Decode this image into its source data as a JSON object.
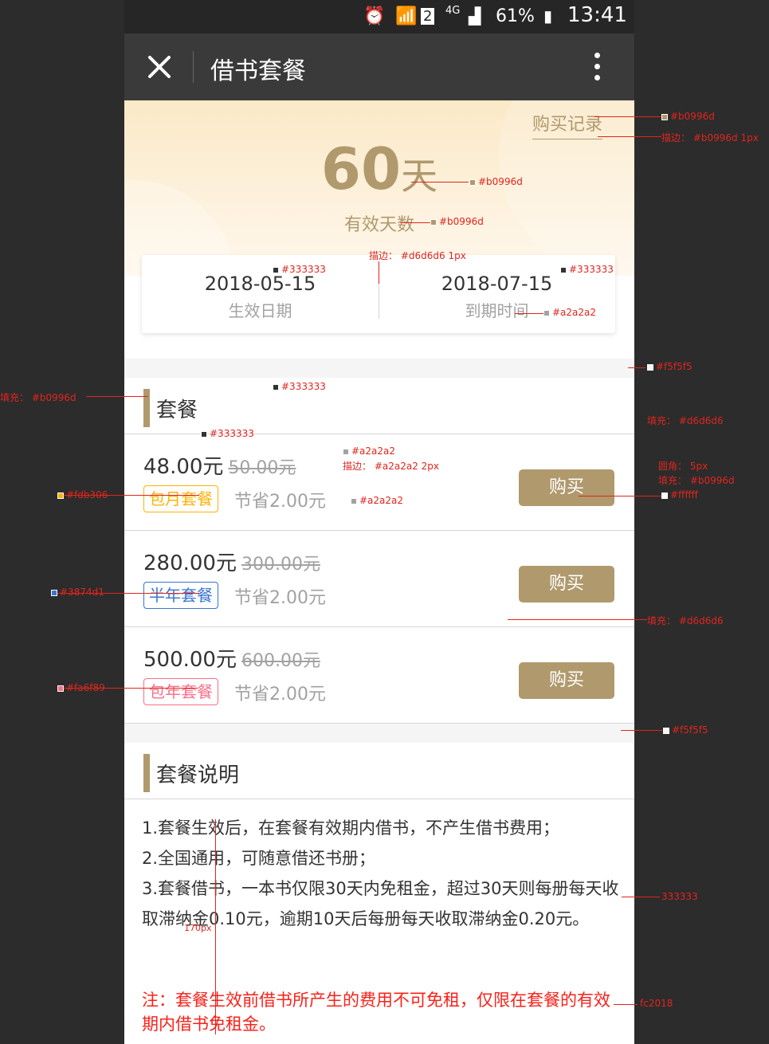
{
  "status_bar": {
    "battery": "61%",
    "time": "13:41",
    "network": "4G",
    "sim": "2"
  },
  "nav": {
    "title": "借书套餐"
  },
  "hero": {
    "record_link": "购买记录",
    "days_number": "60",
    "days_unit": "天",
    "days_label": "有效天数"
  },
  "dates": {
    "start": {
      "date": "2018-05-15",
      "label": "生效日期"
    },
    "end": {
      "date": "2018-07-15",
      "label": "到期时间"
    }
  },
  "plans_section": {
    "title": "套餐"
  },
  "plans": [
    {
      "price": "48.00元",
      "original": "50.00元",
      "tag": "包月套餐",
      "tag_color": "#fdb306",
      "saving": "节省2.00元",
      "buy": "购买"
    },
    {
      "price": "280.00元",
      "original": "300.00元",
      "tag": "半年套餐",
      "tag_color": "#3874d1",
      "saving": "节省2.00元",
      "buy": "购买"
    },
    {
      "price": "500.00元",
      "original": "600.00元",
      "tag": "包年套餐",
      "tag_color": "#fa6f89",
      "saving": "节省2.00元",
      "buy": "购买"
    }
  ],
  "desc_section": {
    "title": "套餐说明",
    "lines": [
      "1.套餐生效后，在套餐有效期内借书，不产生借书费用；",
      "2.全国通用，可随意借还书册；",
      "3.套餐借书，一本书仅限30天内免租金，超过30天则每册每天收取滞纳金0.10元，逾期10天后每册每天收取滞纳金0.20元。"
    ],
    "note": "注：套餐生效前借书所产生的费用不可免租，仅限在套餐的有效期内借书免租金。"
  },
  "colors": {
    "accent": "#b0996d",
    "text": "#333333",
    "muted": "#a2a2a2",
    "divider": "#d6d6d6",
    "bg": "#f5f5f5",
    "warning": "#fc2018",
    "white": "#ffffff"
  },
  "annotations": {
    "a1": "#b0996d",
    "a2": "描边： #b0996d  1px",
    "a3": "#b0996d",
    "a4": "#b0996d",
    "a5": "描边： #d6d6d6  1px",
    "a6": "#333333",
    "a7": "#333333",
    "a8": "#a2a2a2",
    "a9": "#f5f5f5",
    "a10": "填充： #b0996d",
    "a11": "#333333",
    "a12": "填充： #d6d6d6",
    "a13": "#333333",
    "a14": "#a2a2a2",
    "a15": "描边： #a2a2a2  2px",
    "a16": "圆角： 5px",
    "a17": "填充： #b0996d",
    "a18": "#fdb306",
    "a19": "#a2a2a2",
    "a20": "#ffffff",
    "a21": "#3874d1",
    "a22": "填充： #d6d6d6",
    "a23": "#fa6f89",
    "a24": "#f5f5f5",
    "a25": "333333",
    "a26": "170px",
    "a27": "fc2018"
  }
}
